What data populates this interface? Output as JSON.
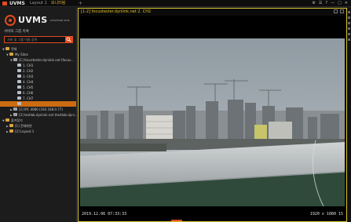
{
  "app": {
    "name": "UVMS",
    "tabs": [
      {
        "label": "Layout 1",
        "active": false
      },
      {
        "label": "모니터링",
        "active": true
      }
    ],
    "add_tab": "+",
    "controls": [
      "⚙",
      "☰",
      "?",
      "—",
      "▢",
      "✕"
    ]
  },
  "brand": {
    "name": "UVMS",
    "subtitle": "universal vms"
  },
  "sidebar": {
    "title": "서버와 그룹 목록",
    "search_placeholder": "서버 및 그룹 이름 검색",
    "tree": [
      {
        "label": "전체",
        "icon": "folder-icon",
        "depth": 0,
        "arrow": "▼"
      },
      {
        "label": "My Sites",
        "icon": "folder-icon",
        "depth": 1,
        "arrow": "▼"
      },
      {
        "label": "[1] focustester.dyniink.net (focus...",
        "icon": "server-icon",
        "depth": 2,
        "arrow": "▼"
      },
      {
        "label": "1. CH1",
        "icon": "camera-icon",
        "depth": 3,
        "arrow": ""
      },
      {
        "label": "2. CH2",
        "icon": "camera-icon",
        "depth": 3,
        "arrow": ""
      },
      {
        "label": "3. CH3",
        "icon": "camera-icon",
        "depth": 3,
        "arrow": ""
      },
      {
        "label": "4. CH4",
        "icon": "camera-icon",
        "depth": 3,
        "arrow": ""
      },
      {
        "label": "5. CH5",
        "icon": "camera-icon",
        "depth": 3,
        "arrow": ""
      },
      {
        "label": "6. CH6",
        "icon": "camera-icon",
        "depth": 3,
        "arrow": ""
      },
      {
        "label": "7. CH7",
        "icon": "camera-icon",
        "depth": 3,
        "arrow": ""
      },
      {
        "label": "",
        "icon": "camera-icon",
        "depth": 3,
        "arrow": "",
        "selected": true
      },
      {
        "label": "[2] IPC 4080 (192.168.0.77)",
        "icon": "server-icon",
        "depth": 2,
        "arrow": "▶"
      },
      {
        "label": "[3] testlab.dyniink.net (testlab.dyni...",
        "icon": "server-icon",
        "depth": 2,
        "arrow": "▶"
      },
      {
        "label": "즐겨찾기",
        "icon": "folder-icon",
        "depth": 0,
        "arrow": "▼"
      },
      {
        "label": "[1] 전체화면",
        "icon": "folder-icon",
        "depth": 1,
        "arrow": "▶"
      },
      {
        "label": "[2] Layout 1",
        "icon": "folder-icon",
        "depth": 1,
        "arrow": "▶"
      }
    ]
  },
  "video": {
    "title": "[1-2] focustester.dynlink.net  2. CH2",
    "timestamp": "2019.12.06 07:33:33",
    "resolution": "1920 x 1080 15"
  }
}
